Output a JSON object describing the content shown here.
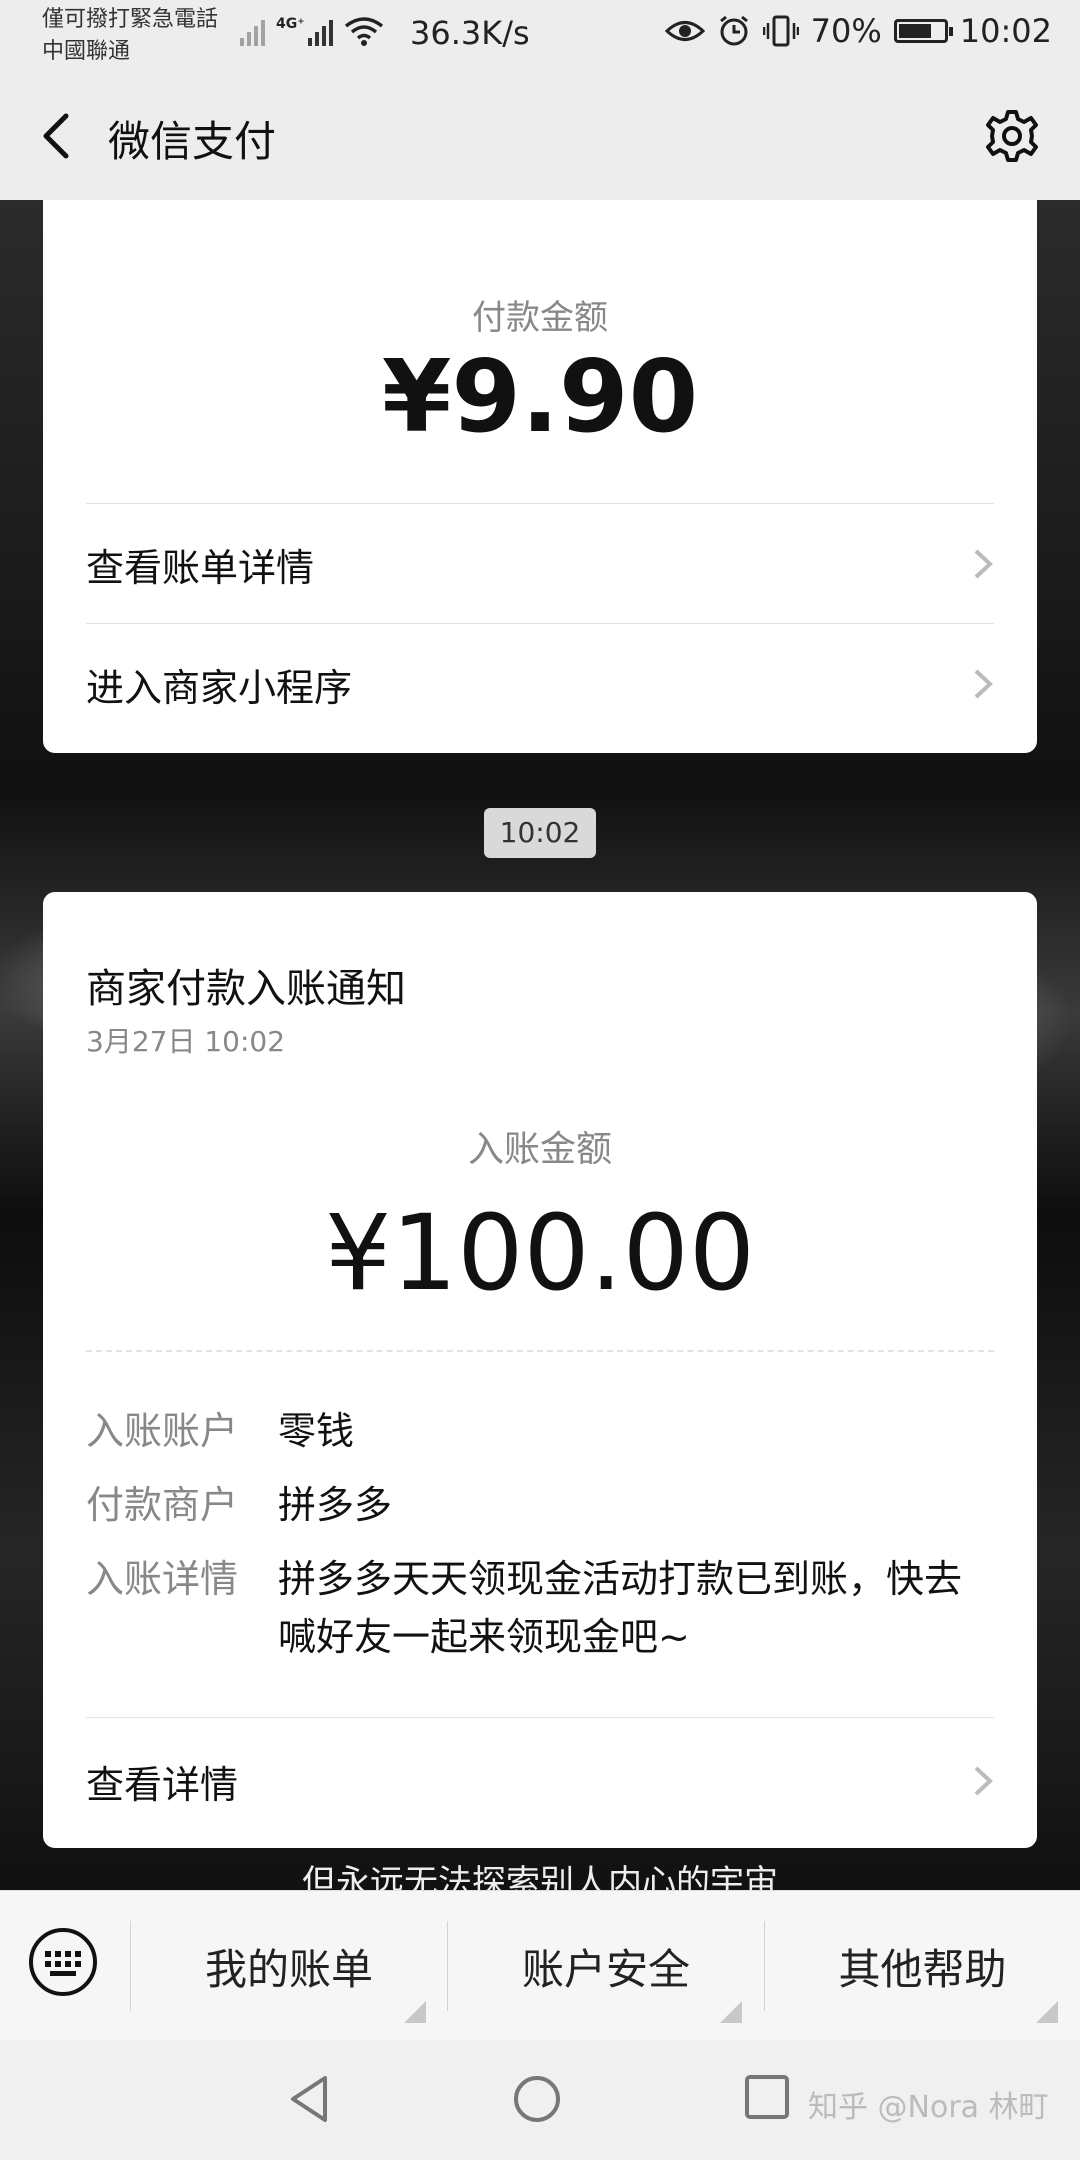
{
  "status_bar": {
    "emergency": "僅可撥打緊急電話",
    "carrier": "中國聯通",
    "network_type": "4G⁺",
    "speed": "36.3K/s",
    "battery": "70%",
    "battery_level": 0.7,
    "time": "10:02"
  },
  "header": {
    "title": "微信支付",
    "back_icon": "chevron-left-icon",
    "settings_icon": "gear-icon"
  },
  "card1": {
    "amount_label": "付款金额",
    "amount": "¥9.90",
    "rows": [
      "查看账单详情",
      "进入商家小程序"
    ]
  },
  "time_separator": "10:02",
  "card2": {
    "title": "商家付款入账通知",
    "date": "3月27日 10:02",
    "amount_label": "入账金额",
    "amount": "¥100.00",
    "details": [
      {
        "key": "入账账户",
        "value": "零钱"
      },
      {
        "key": "付款商户",
        "value": "拼多多"
      },
      {
        "key": "入账详情",
        "value": "拼多多天天领现金活动打款已到账，快去喊好友一起来领现金吧~"
      }
    ],
    "view_details": "查看详情"
  },
  "background_caption": "但永远无法探索别人内心的宇宙",
  "bottom_menu": [
    "我的账单",
    "账户安全",
    "其他帮助"
  ],
  "watermark": "知乎 @Nora 林町",
  "colors": {
    "card": "#ffffff",
    "bar": "#ededed",
    "label_gray": "#888888"
  }
}
